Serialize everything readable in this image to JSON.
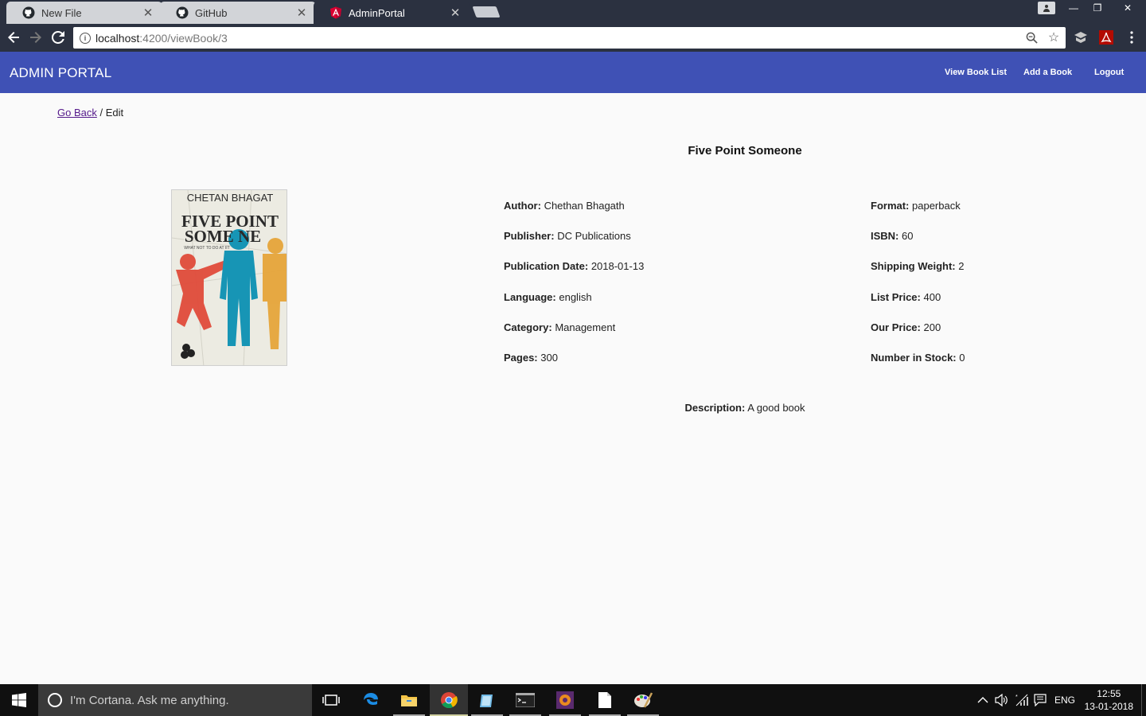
{
  "browser": {
    "tabs": [
      {
        "title": "New File",
        "icon": "github-icon"
      },
      {
        "title": "GitHub",
        "icon": "github-icon"
      },
      {
        "title": "AdminPortal",
        "icon": "angular-icon"
      }
    ],
    "url_host": "localhost",
    "url_path": ":4200/viewBook/3"
  },
  "navbar": {
    "brand": "ADMIN PORTAL",
    "links": [
      "View Book List",
      "Add a Book",
      "Logout"
    ],
    "background": "#3f51b5"
  },
  "breadcrumb": {
    "back": "Go Back",
    "separator": "/",
    "current": "Edit"
  },
  "book": {
    "title": "Five Point Someone",
    "cover": {
      "author_line": "CHETAN BHAGAT",
      "title_line1": "FIVE POINT",
      "title_line2": "SOME NE",
      "tagline": "WHAT NOT TO DO AT IIT"
    },
    "left_fields": [
      {
        "label": "Author:",
        "value": "Chethan Bhagath"
      },
      {
        "label": "Publisher:",
        "value": "DC Publications"
      },
      {
        "label": "Publication Date:",
        "value": "2018-01-13"
      },
      {
        "label": "Language:",
        "value": "english"
      },
      {
        "label": "Category:",
        "value": "Management"
      },
      {
        "label": "Pages:",
        "value": "300"
      }
    ],
    "right_fields": [
      {
        "label": "Format:",
        "value": "paperback"
      },
      {
        "label": "ISBN:",
        "value": "60"
      },
      {
        "label": "Shipping Weight:",
        "value": "2"
      },
      {
        "label": "List Price:",
        "value": "400"
      },
      {
        "label": "Our Price:",
        "value": "200"
      },
      {
        "label": "Number in Stock:",
        "value": "0"
      }
    ],
    "description_label": "Description:",
    "description": "A good book"
  },
  "taskbar": {
    "cortana_placeholder": "I'm Cortana. Ask me anything.",
    "language": "ENG",
    "time": "12:55",
    "date": "13-01-2018"
  }
}
